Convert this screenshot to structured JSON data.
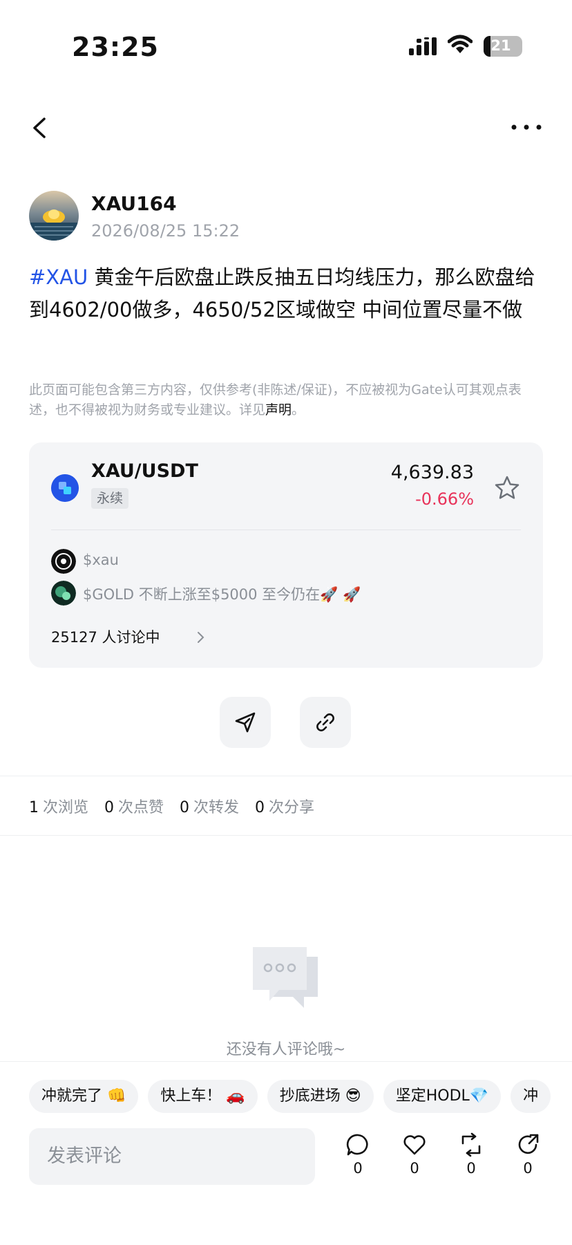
{
  "status_bar": {
    "time": "23:25",
    "battery": "21"
  },
  "author": {
    "name": "XAU164",
    "time": "2026/08/25 15:22"
  },
  "post": {
    "hashtag": "#XAU",
    "text": " 黄金午后欧盘止跌反抽五日均线压力，那么欧盘给到4602/00做多，4650/52区域做空 中间位置尽量不做"
  },
  "disclaimer": {
    "text": "此页面可能包含第三方内容，仅供参考(非陈述/保证)，不应被视为Gate认可其观点表述，也不得被视为财务或专业建议。详见",
    "link": "声明",
    "end": "。"
  },
  "market_card": {
    "pair": "XAU/USDT",
    "tag": "永续",
    "price": "4,639.83",
    "change": "-0.66%",
    "change_color": "#e8335a",
    "topics": [
      {
        "text": "$xau"
      },
      {
        "text": "$GOLD  不断上涨至$5000 至今仍在🚀 🚀"
      }
    ],
    "discussion": "25127 人讨论中"
  },
  "stats": [
    {
      "num": "1",
      "label": "次浏览"
    },
    {
      "num": "0",
      "label": "次点赞"
    },
    {
      "num": "0",
      "label": "次转发"
    },
    {
      "num": "0",
      "label": "次分享"
    }
  ],
  "empty_state": {
    "text": "还没有人评论哦~"
  },
  "quick_replies": [
    "冲就完了 👊",
    "快上车！ 🚗",
    "抄底进场 😎",
    "坚定HODL💎",
    "冲"
  ],
  "comment_input": {
    "placeholder": "发表评论"
  },
  "actions": {
    "comment": "0",
    "like": "0",
    "repost": "0",
    "share": "0"
  },
  "colors": {
    "accent": "#2354e6",
    "negative": "#e8335a",
    "muted": "#8a8f96"
  }
}
